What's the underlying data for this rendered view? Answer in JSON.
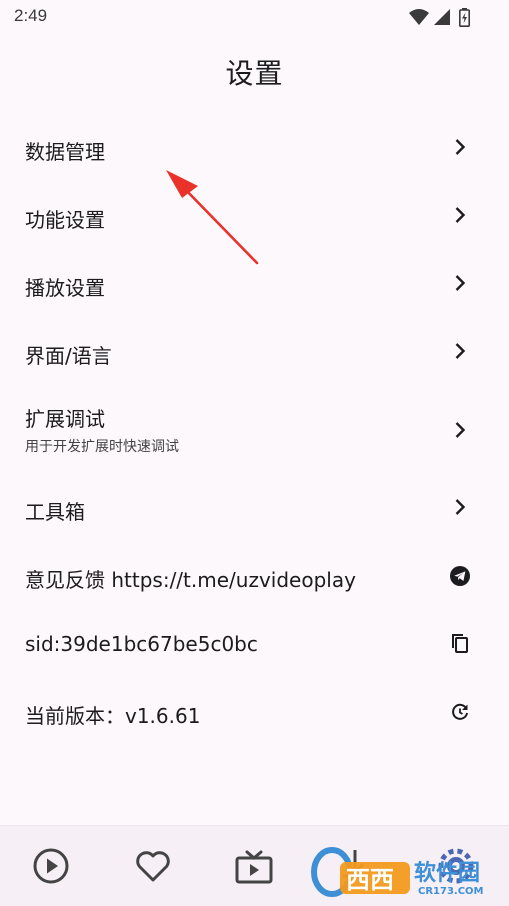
{
  "status": {
    "time": "2:49"
  },
  "page": {
    "title": "设置"
  },
  "menu": {
    "items": [
      {
        "label": "数据管理"
      },
      {
        "label": "功能设置"
      },
      {
        "label": "播放设置"
      },
      {
        "label": "界面/语言"
      },
      {
        "label": "扩展调试",
        "subtitle": "用于开发扩展时快速调试"
      },
      {
        "label": "工具箱"
      },
      {
        "label": "意见反馈 https://t.me/uzvideoplay"
      },
      {
        "label": "sid:39de1bc67be5c0bc"
      },
      {
        "label": "当前版本：v1.6.61"
      }
    ]
  },
  "watermark": {
    "text_top": "西西",
    "text_right": "软件园",
    "domain": "CR173.COM"
  },
  "colors": {
    "background": "#fdf8fc",
    "nav_background": "#f6eff6",
    "annotation": "#e8322a"
  },
  "icons": [
    "wifi-icon",
    "signal-icon",
    "battery-icon",
    "chevron-right-icon",
    "telegram-icon",
    "copy-icon",
    "refresh-icon",
    "play-icon",
    "heart-icon",
    "tv-icon",
    "download-icon",
    "settings-gear-icon"
  ]
}
